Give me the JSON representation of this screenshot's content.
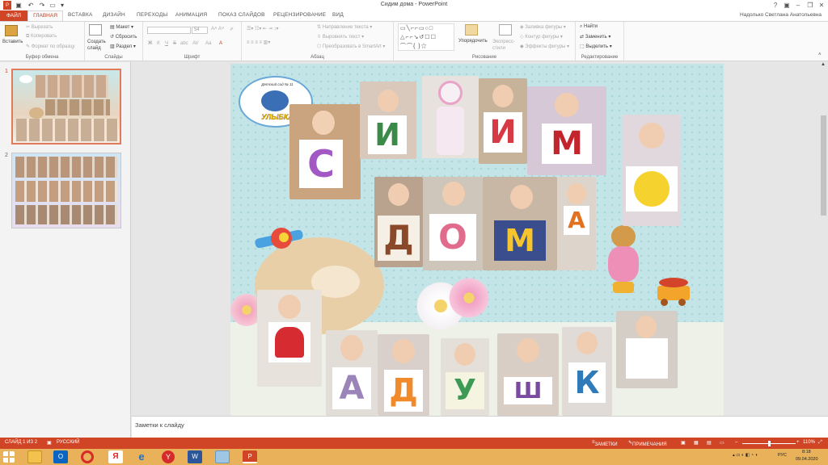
{
  "window": {
    "title": "Сидим дома - PowerPoint",
    "user": "Надолько Светлана Анатольевна",
    "help": "?"
  },
  "tabs": [
    "ФАЙЛ",
    "ГЛАВНАЯ",
    "ВСТАВКА",
    "ДИЗАЙН",
    "ПЕРЕХОДЫ",
    "АНИМАЦИЯ",
    "ПОКАЗ СЛАЙДОВ",
    "РЕЦЕНЗИРОВАНИЕ",
    "ВИД"
  ],
  "ribbon": {
    "clipboard": {
      "label": "Буфер обмена",
      "paste": "Вставить",
      "cut": "Вырезать",
      "copy": "Копировать",
      "format": "Формат по образцу"
    },
    "slides": {
      "label": "Слайды",
      "create": "Создать слайд",
      "layout": "Макет",
      "reset": "Сбросить",
      "section": "Раздел"
    },
    "font": {
      "label": "Шрифт",
      "size": "54",
      "bold": "Ж",
      "italic": "К",
      "underline": "Ч",
      "strike": "S",
      "shadow": "abc",
      "spacing": "AV",
      "case": "Aa",
      "color": "A"
    },
    "paragraph": {
      "label": "Абзац",
      "direction": "Направление текста",
      "align": "Выровнять текст",
      "smartart": "Преобразовать в SmartArt"
    },
    "drawing": {
      "label": "Рисование",
      "arrange": "Упорядочить",
      "styles": "Экспресс-стили",
      "fill": "Заливка фигуры",
      "outline": "Контур фигуры",
      "effects": "Эффекты фигуры"
    },
    "editing": {
      "label": "Редактирование",
      "find": "Найти",
      "replace": "Заменить",
      "select": "Выделить"
    }
  },
  "slides": [
    {
      "number": "1"
    },
    {
      "number": "2"
    }
  ],
  "slide": {
    "caption": "Детский сад № 11",
    "logo_text": "УЛЫБКА",
    "letters_top": [
      "С",
      "И",
      "",
      "И",
      "М",
      ""
    ],
    "letters_mid": [
      "Д",
      "О",
      "М",
      "А"
    ],
    "letters_bottom": [
      "",
      "А",
      "Д",
      "У",
      "Ш",
      "К",
      ""
    ]
  },
  "notes": {
    "placeholder": "Заметки к слайду"
  },
  "status": {
    "slide": "СЛАЙД 1 ИЗ 2",
    "language": "РУССКИЙ",
    "notes": "ЗАМЕТКИ",
    "comments": "ПРИМЕЧАНИЯ",
    "zoom": "110%"
  },
  "taskbar": {
    "lang": "РУС",
    "time": "8:18",
    "date": "09.04.2020"
  },
  "colors": {
    "accent": "#d04525",
    "slide_bg": "#bfe3e6"
  }
}
